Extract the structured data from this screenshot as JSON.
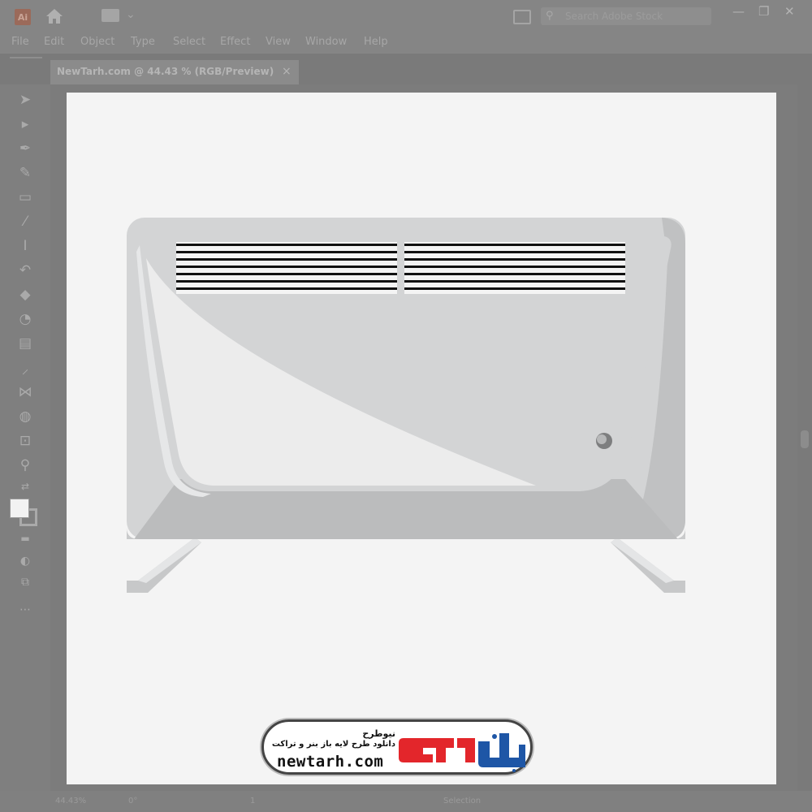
{
  "app": {
    "logo_text": "Ai",
    "search_placeholder": "Search Adobe Stock"
  },
  "menu": [
    "File",
    "Edit",
    "Object",
    "Type",
    "Select",
    "Effect",
    "View",
    "Window",
    "Help"
  ],
  "document_tab": {
    "title": "NewTarh.com @ 44.43 % (RGB/Preview)",
    "close": "×"
  },
  "window_controls": {
    "minimize": "—",
    "restore": "❐",
    "close": "✕"
  },
  "status": {
    "zoom": "44.43%",
    "rotation": "0°",
    "artboard_nav": "1",
    "tool_name": "Selection"
  },
  "watermark": {
    "brand_fa": "نیوطرح",
    "tagline_fa": "دانلود طرح لایه باز بنر و تراکت",
    "url": "newtarh.com",
    "logo_colors": {
      "red": "#e3262b",
      "blue": "#1e56a6"
    }
  },
  "colors": {
    "heater_body": "#d3d4d5",
    "heater_highlight": "#ececec",
    "heater_shadow": "#b9babb",
    "grille_dark": "#111111"
  },
  "tools": [
    "select-icon",
    "direct-select-icon",
    "pen-icon",
    "curvature-icon",
    "rectangle-icon",
    "paintbrush-icon",
    "type-icon",
    "rotate-icon",
    "eraser-icon",
    "shape-builder-icon",
    "gradient-icon",
    "eyedropper-icon",
    "blend-icon",
    "symbol-sprayer-icon",
    "artboard-icon",
    "zoom-icon"
  ]
}
